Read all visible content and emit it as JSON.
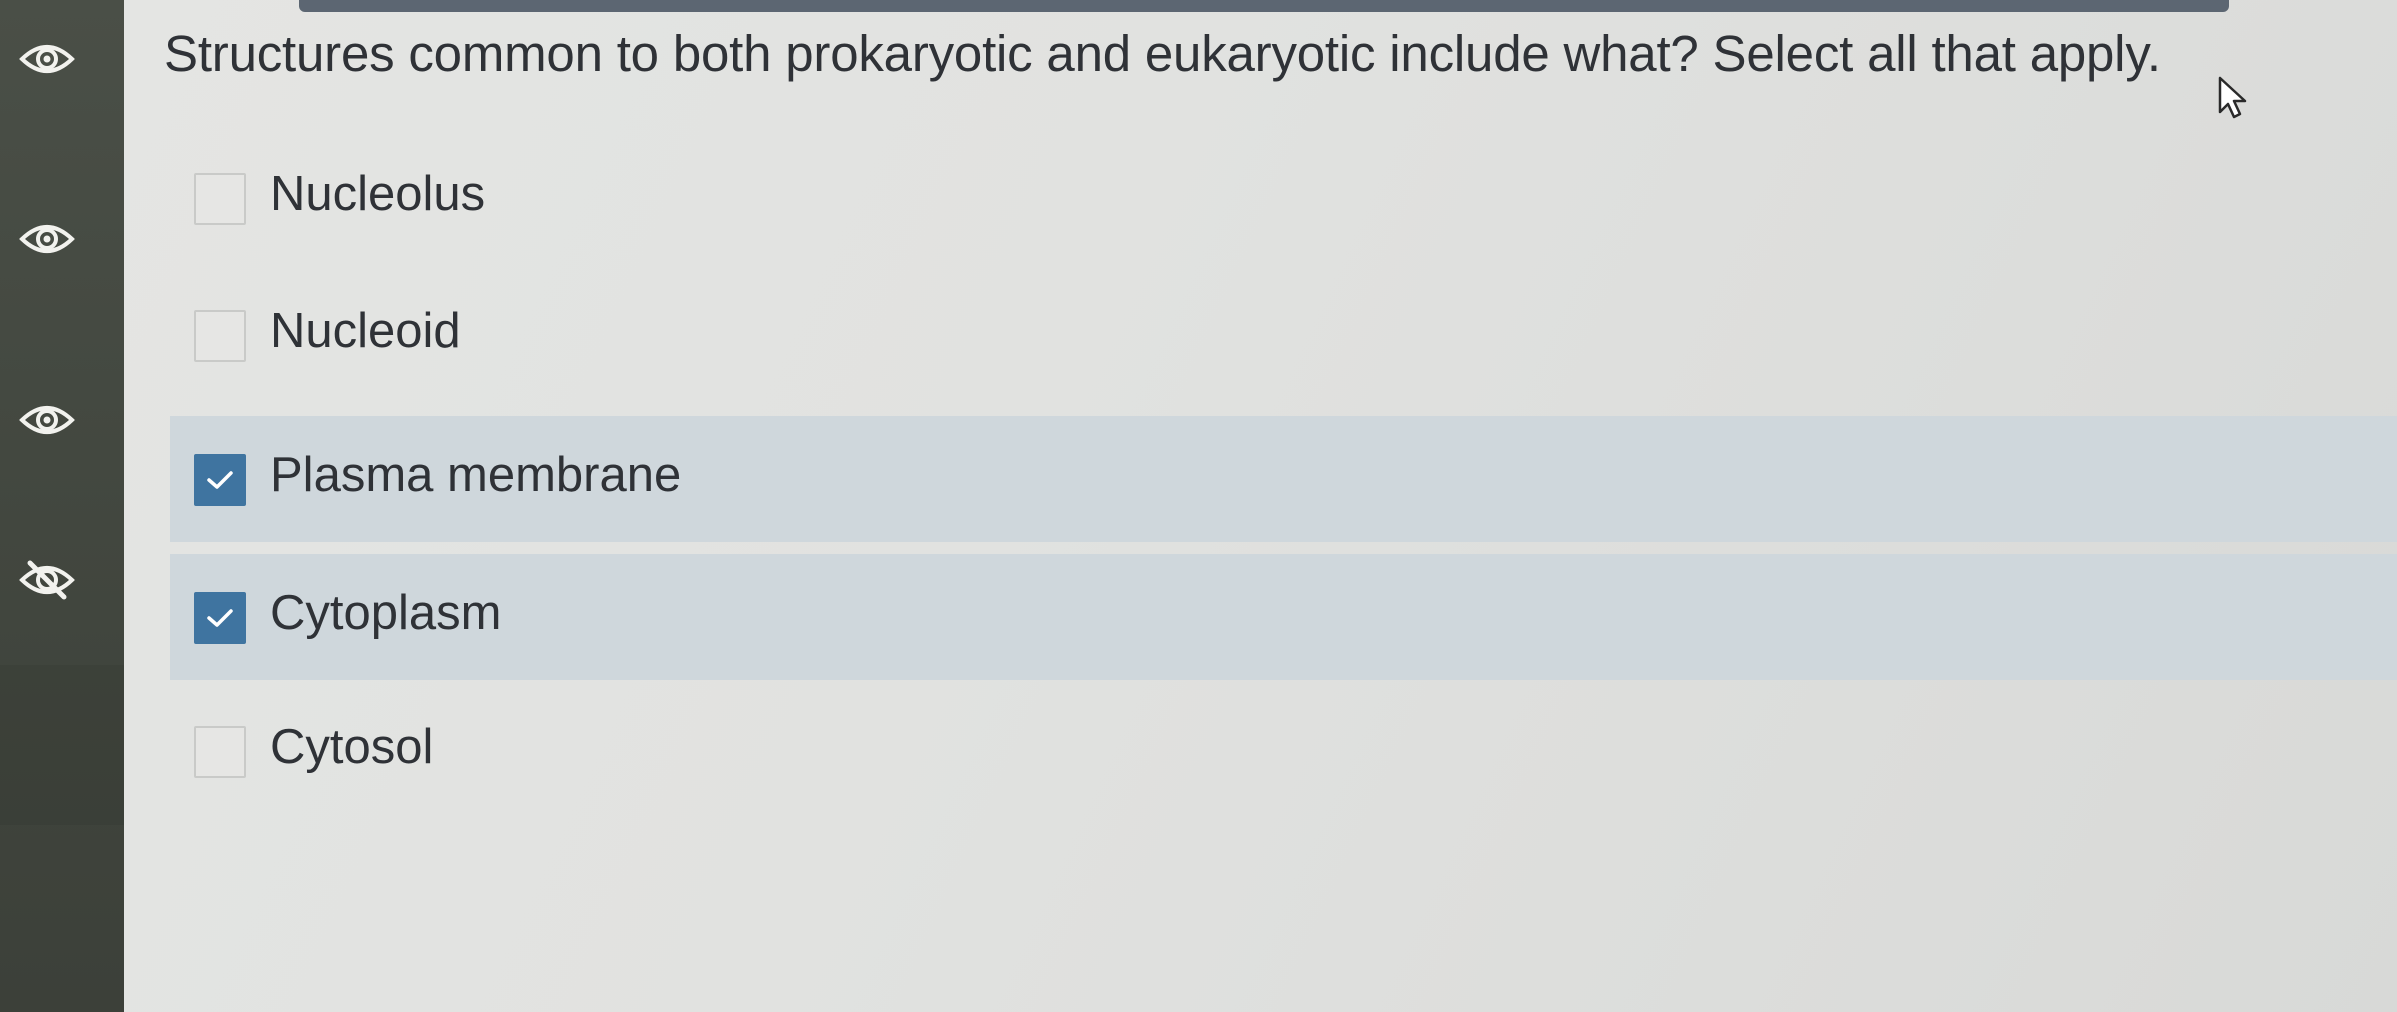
{
  "question": {
    "text": "Structures common to both prokaryotic and eukaryotic include what? Select all that apply."
  },
  "options": [
    {
      "label": "Nucleolus",
      "checked": false
    },
    {
      "label": "Nucleoid",
      "checked": false
    },
    {
      "label": "Plasma membrane",
      "checked": true
    },
    {
      "label": "Cytoplasm",
      "checked": true
    },
    {
      "label": "Cytosol",
      "checked": false
    }
  ],
  "sidebar": {
    "icons": [
      "eye-icon",
      "eye-icon",
      "eye-icon",
      "eye-slash-icon"
    ]
  },
  "colors": {
    "accent": "#3f74a0",
    "selected_row": "#cfd7dc",
    "sidebar": "#474c44",
    "text": "#2f3237"
  }
}
